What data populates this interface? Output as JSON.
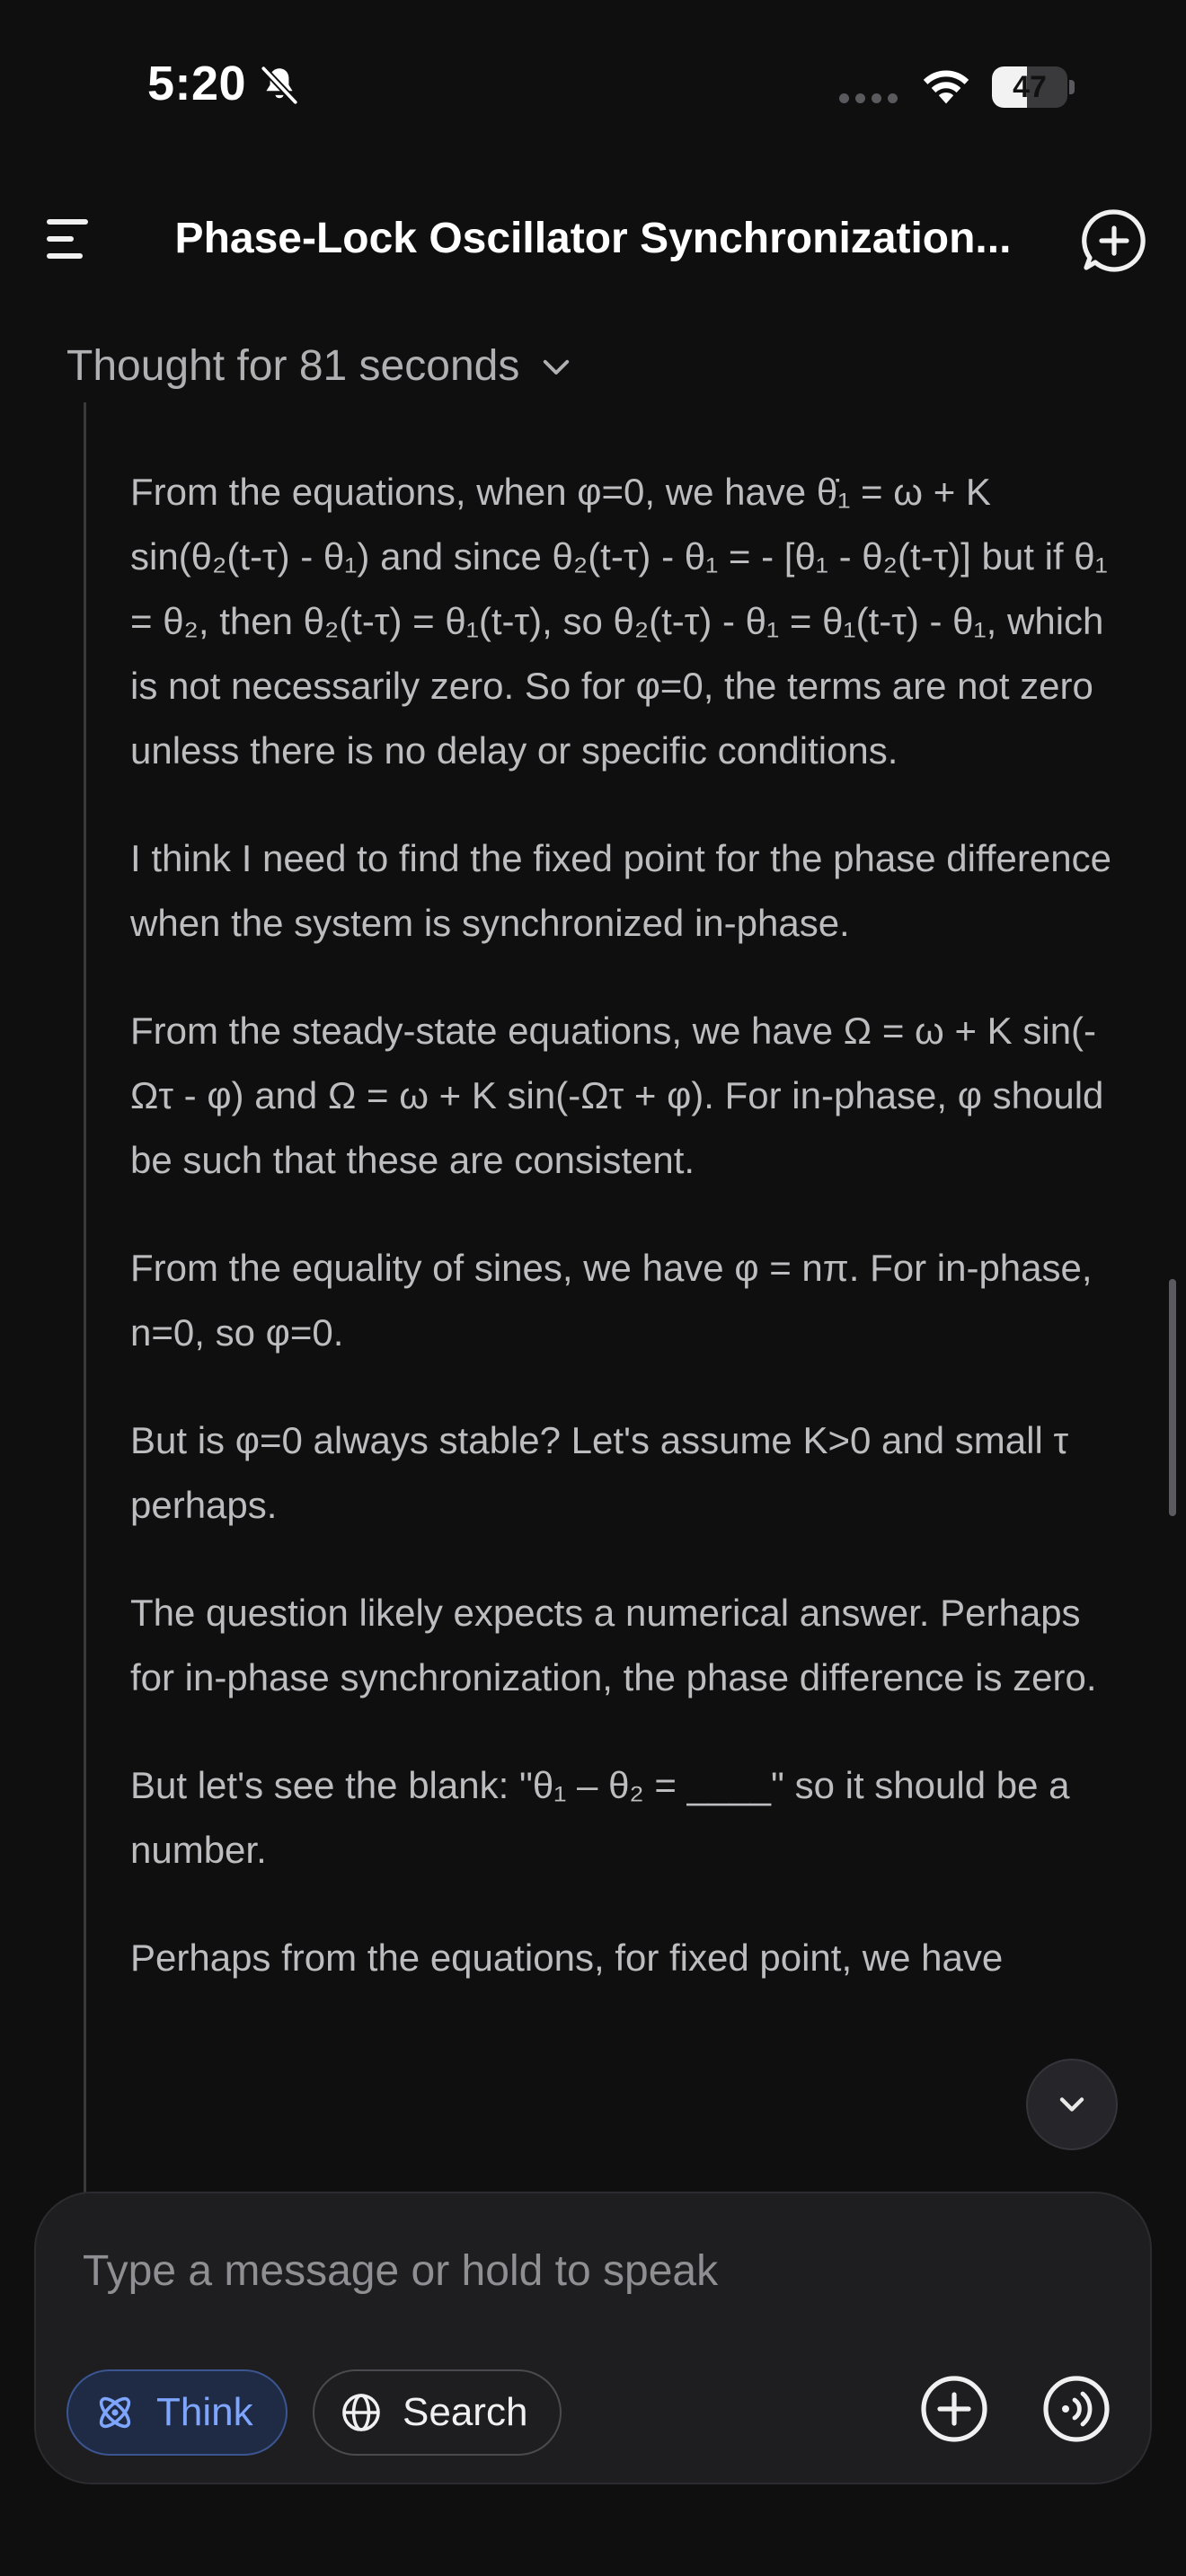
{
  "status_bar": {
    "time": "5:20",
    "battery_level": "47",
    "icons": [
      "bell-slash-icon",
      "cellular-dots-icon",
      "wifi-icon",
      "battery-icon"
    ]
  },
  "header": {
    "title": "Phase-Lock Oscillator Synchronization...",
    "menu_icon": "menu-icon",
    "new_chat_icon": "new-chat-icon"
  },
  "thought": {
    "label": "Thought for 81 seconds",
    "expanded": true
  },
  "reasoning_paragraphs": [
    "From the equations, when φ=0, we have θ̇₁ = ω + K sin(θ₂(t-τ) - θ₁) and since θ₂(t-τ) - θ₁ = - [θ₁ - θ₂(t-τ)] but if θ₁ = θ₂, then θ₂(t-τ) = θ₁(t-τ), so θ₂(t-τ) - θ₁ = θ₁(t-τ) - θ₁, which is not necessarily zero. So for φ=0, the terms are not zero unless there is no delay or specific conditions.",
    "I think I need to find the fixed point for the phase difference when the system is synchronized in-phase.",
    "From the steady-state equations, we have Ω = ω + K sin(-Ωτ - φ) and Ω = ω + K sin(-Ωτ + φ). For in-phase, φ should be such that these are consistent.",
    "From the equality of sines, we have φ = nπ. For in-phase, n=0, so φ=0.",
    "But is φ=0 always stable? Let's assume K>0 and small τ perhaps.",
    "The question likely expects a numerical answer. Perhaps for in-phase synchronization, the phase difference is zero.",
    "But let's see the blank: \"θ₁ – θ₂ = ____\" so it should be a number.",
    "Perhaps from the equations, for fixed point, we have"
  ],
  "composer": {
    "placeholder": "Type a message or hold to speak",
    "think_label": "Think",
    "think_active": true,
    "search_label": "Search",
    "search_active": false
  },
  "colors": {
    "background": "#0f0f10",
    "composer_bg": "#1e1e21",
    "think_accent": "#7ea6ff",
    "body_text": "#bdbdc0"
  }
}
